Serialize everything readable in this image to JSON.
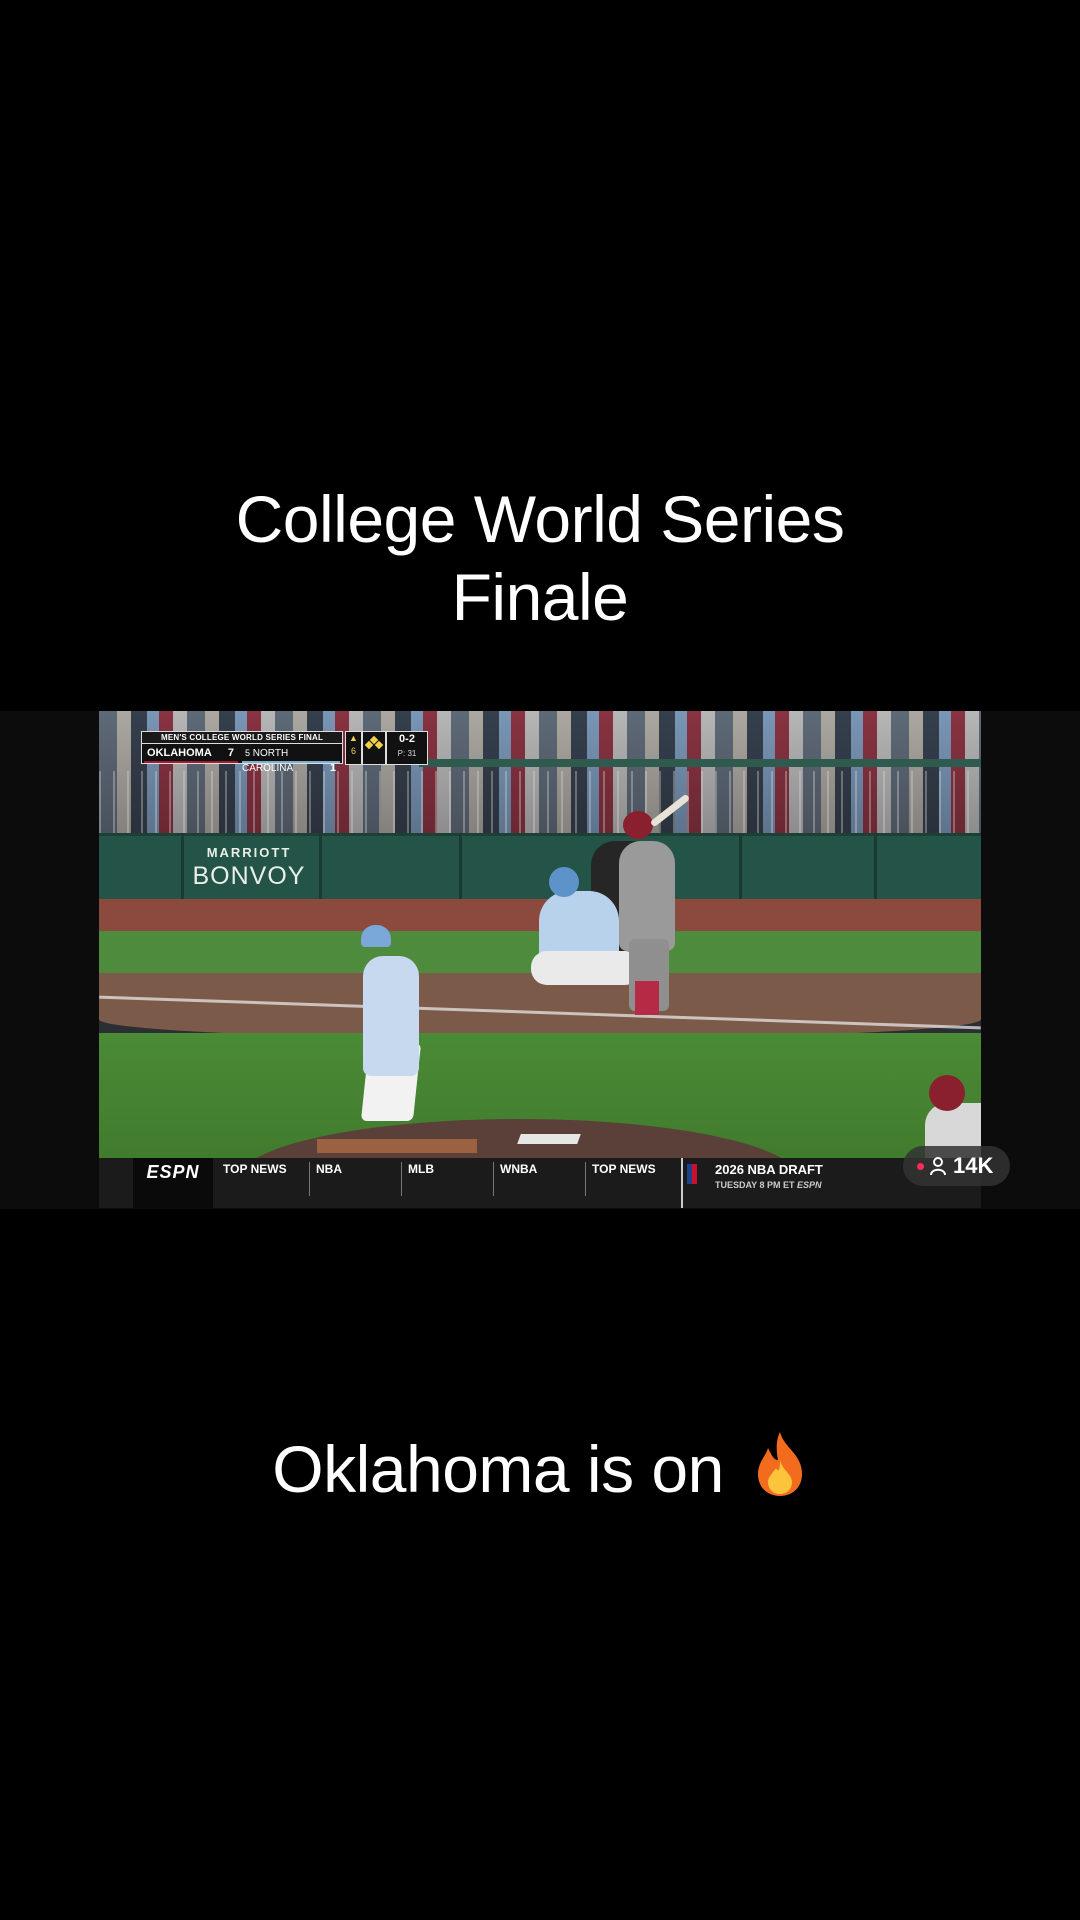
{
  "overlay": {
    "title_line1": "College World Series",
    "title_line2": "Finale",
    "caption": "Oklahoma is on",
    "caption_emoji": "fire-emoji"
  },
  "scorebug": {
    "header": "MEN'S COLLEGE WORLD SERIES FINAL",
    "away_team": "OKLAHOMA",
    "away_score": "7",
    "home_rank": "5",
    "home_team": "NORTH CAROLINA",
    "home_score": "1",
    "inning_arrow": "▲",
    "inning": "6",
    "count": "0-2",
    "pitch_count": "P: 31"
  },
  "ad_board": {
    "line1": "MARRIOTT",
    "line2": "BONVOY"
  },
  "ticker": {
    "network": "ESPN",
    "items": [
      "TOP NEWS",
      "NBA",
      "MLB",
      "WNBA",
      "TOP NEWS"
    ],
    "promo_title": "2026 NBA DRAFT",
    "promo_sub": "TUESDAY 8 PM ET",
    "promo_net": "ESPN"
  },
  "live": {
    "viewers": "14K"
  },
  "colors": {
    "oklahoma": "#a11a2e",
    "north_carolina": "#7bafd4",
    "live_dot": "#ff2b55"
  }
}
